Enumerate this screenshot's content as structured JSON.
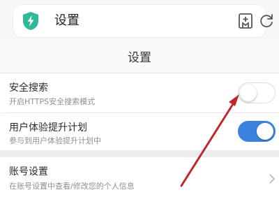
{
  "address_bar": {
    "title": "设置"
  },
  "header": {
    "title": "设置"
  },
  "settings": {
    "safe_search": {
      "title": "安全搜索",
      "subtitle": "开启HTTPS安全搜索模式",
      "enabled": false
    },
    "user_experience": {
      "title": "用户体验提升计划",
      "subtitle": "参与到用户体验提升计划中",
      "enabled": true
    },
    "account": {
      "title": "账号设置",
      "subtitle": "在账号设置中查看/修改您的个人信息"
    }
  },
  "colors": {
    "accent": "#3b82e0",
    "shield": "#2fb89a",
    "annotation_arrow": "#c0272d"
  },
  "icons": [
    "shield-icon",
    "bookmark-add-icon",
    "refresh-icon",
    "chevron-right-icon"
  ]
}
